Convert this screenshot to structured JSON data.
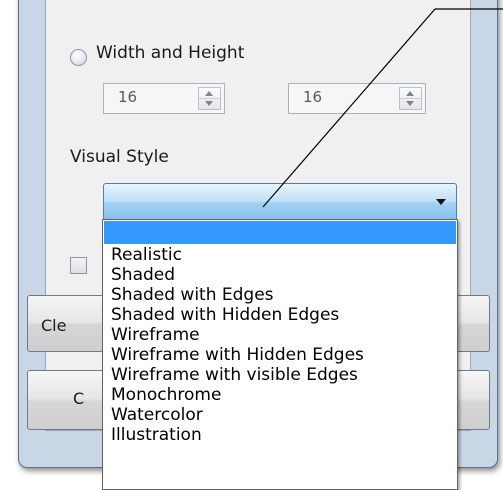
{
  "dialog": {
    "size_option_label": "Width and Height",
    "width_value": "16",
    "height_value": "16",
    "visual_style_label": "Visual Style",
    "visual_style_selected": "",
    "clear_button_partial": "Cle",
    "second_button_partial": "C"
  },
  "visual_style_options": [
    "Realistic",
    "Shaded",
    "Shaded with Edges",
    "Shaded with Hidden Edges",
    "Wireframe",
    "Wireframe with Hidden Edges",
    "Wireframe with visible Edges",
    "Monochrome",
    "Watercolor",
    "Illustration"
  ],
  "colors": {
    "selection_highlight": "#3399ff",
    "combo_border": "#4f7fb2",
    "frame": "#c9d6e6"
  }
}
